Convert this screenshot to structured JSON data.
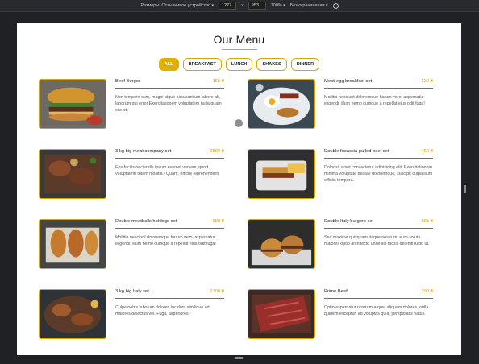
{
  "devtools": {
    "device_label": "Размеры: Отзывчивое устройство",
    "width": "1277",
    "x": "x",
    "height": "953",
    "zoom": "100%",
    "throttle": "Без ограничения"
  },
  "page": {
    "title": "Our Menu",
    "tabs": [
      {
        "label": "All",
        "active": true
      },
      {
        "label": "Breakfast",
        "active": false
      },
      {
        "label": "Lunch",
        "active": false
      },
      {
        "label": "Shakes",
        "active": false
      },
      {
        "label": "Dinner",
        "active": false
      }
    ],
    "items": [
      {
        "name": "Beef Burger",
        "price": "155 ₴",
        "desc": "Non tempore cum, magni atque accusantium labore ab, laborum qui error Exercitationem voluptatem nulla quam site et!"
      },
      {
        "name": "Meat-egg breakfast set",
        "price": "220 ₴",
        "desc": "Mollitia nesciunt doloremque harum vero, aspernatur eligendi, illum nemo cumque a repellat eius odit fuga!"
      },
      {
        "name": "3 kg big meat company set",
        "price": "2560 ₴",
        "desc": "Eos facilis reiciendis ipsum eveniet veniam, quod voluptatem totam mollitia? Quam, officiis reprehenderit."
      },
      {
        "name": "Double focaccia pulled beef set",
        "price": "450 ₴",
        "desc": "Dolor sit amet consectetur adipisicing elit. Exercitationem minima voluptate beatae doloremque, suscipit culpa illum officiis tempora."
      },
      {
        "name": "Double meatballs hotdogs set",
        "price": "680 ₴",
        "desc": "Mollitia nesciunt doloremque harum vero, aspernatur eligendi, illum nemo cumque a repellat eius odit fuga!"
      },
      {
        "name": "Double Italy burgers set",
        "price": "685 ₴",
        "desc": "Sed maxime quisquam itaque nostrum, eum soluta maiores optio architecto unde illo facilis deleniti iusto ut."
      },
      {
        "name": "3 kg big Italy set",
        "price": "2700 ₴",
        "desc": "Culpa nobis laborum dolores incidunt similique ad maiores delectus vel. Fugit, asperiores?"
      },
      {
        "name": "Prime Beef",
        "price": "290 ₴",
        "desc": "Optio aspernatur nostrum atque, aliquam dolores, nulla quidem excepturi ad voluptas quia, perspiciatis natus."
      }
    ]
  }
}
